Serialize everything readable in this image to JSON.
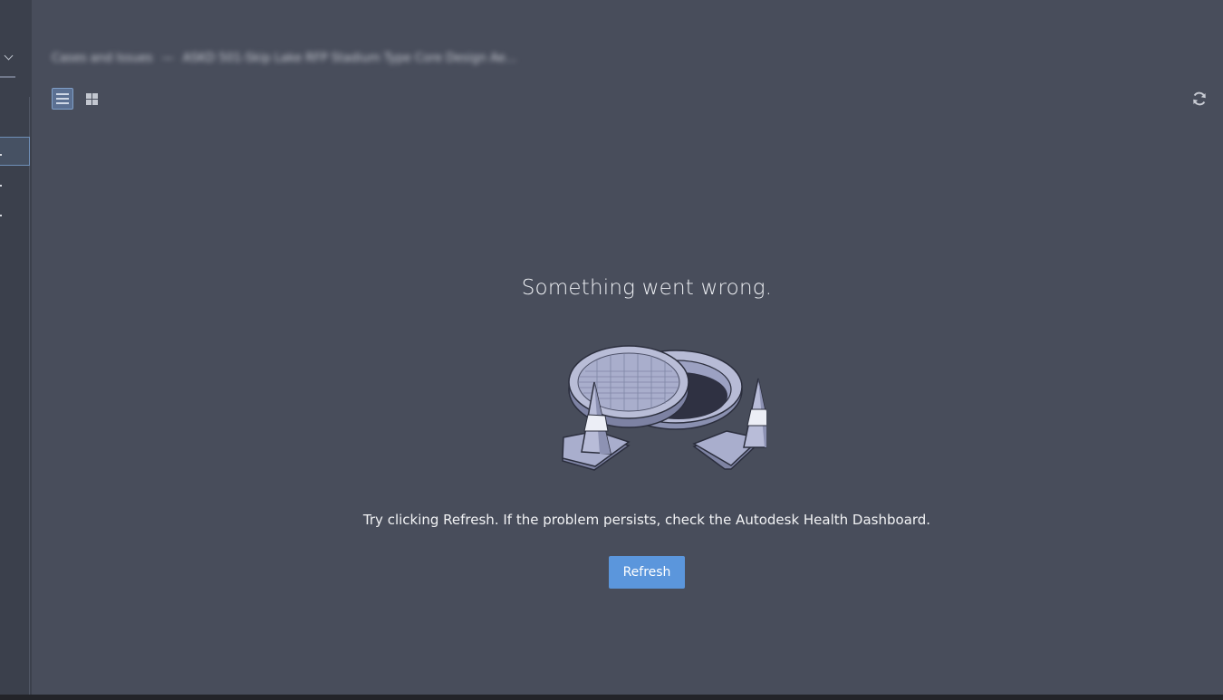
{
  "breadcrumb": {
    "items": [
      "Cases and Issues",
      "—",
      "ASKD 501-Skip Lake RFP Stadium Type Core Design Ae…"
    ]
  },
  "toolbar": {
    "list_view_icon": "list-icon",
    "grid_view_icon": "grid-icon",
    "refresh_icon": "refresh-icon"
  },
  "error": {
    "title": "Something went wrong.",
    "message": "Try clicking Refresh. If the problem persists, check the Autodesk Health Dashboard.",
    "refresh_label": "Refresh",
    "illustration_icon": "manhole-with-traffic-cones-illustration"
  },
  "colors": {
    "background": "#484d5b",
    "sidebar": "#3b404c",
    "accent": "#5b96dc"
  }
}
